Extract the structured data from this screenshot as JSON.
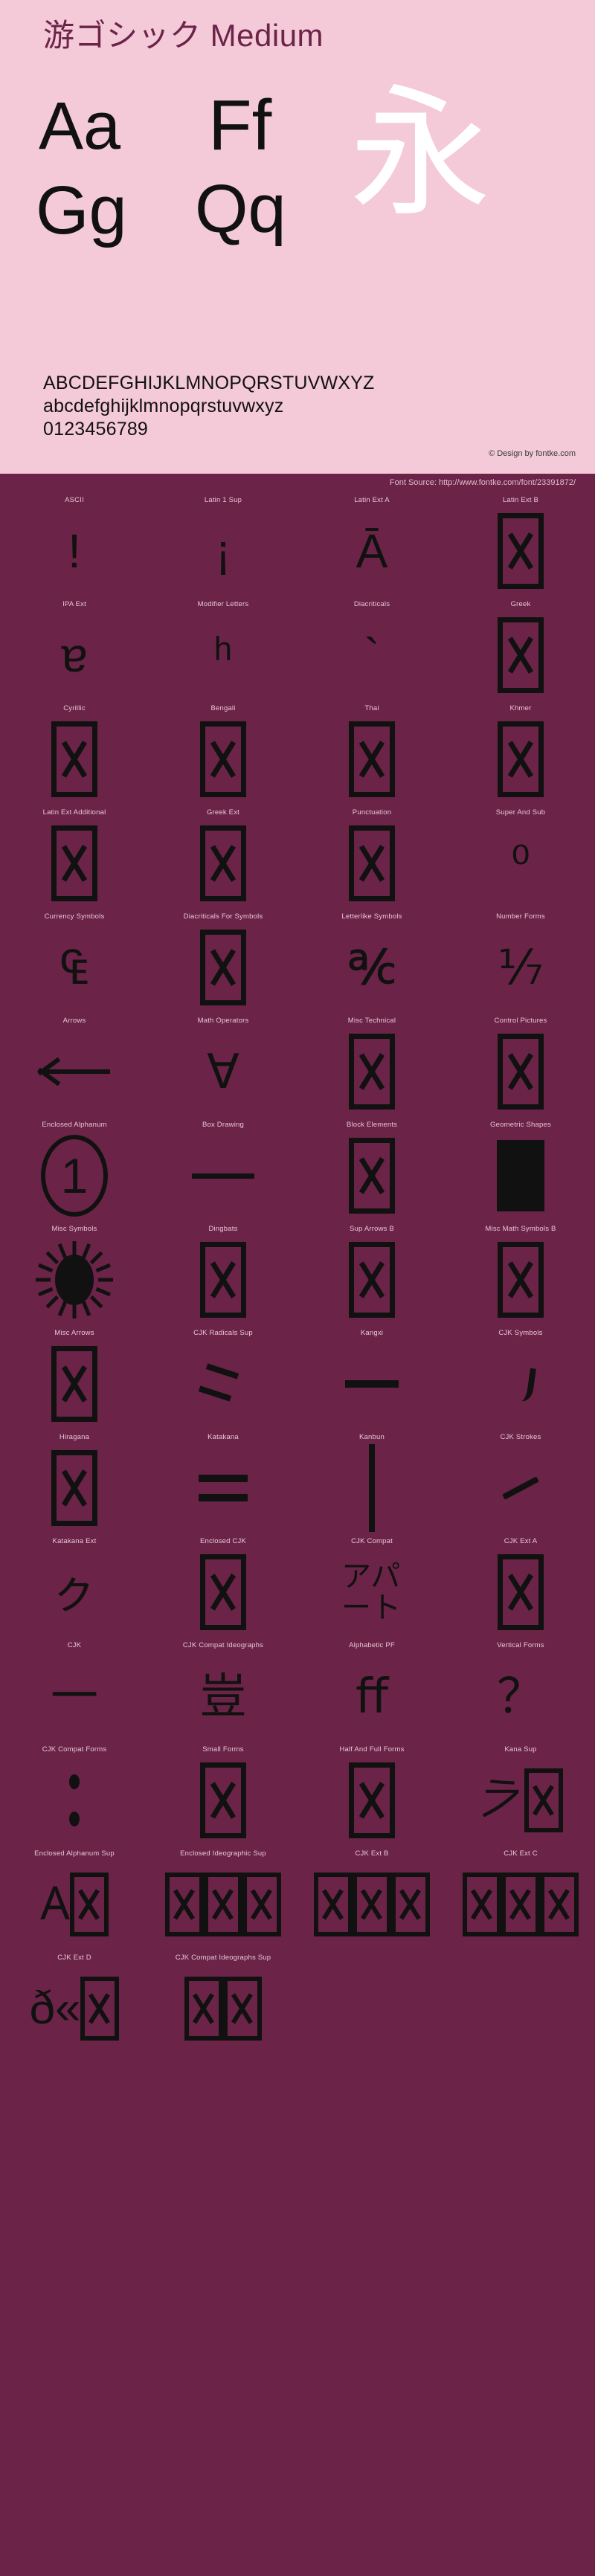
{
  "header": {
    "font_title": "游ゴシック Medium",
    "specimen_pairs": [
      {
        "name": "Aa",
        "text": "Aa"
      },
      {
        "name": "Ff",
        "text": "Ff"
      },
      {
        "name": "Gg",
        "text": "Gg"
      },
      {
        "name": "Qq",
        "text": "Qq"
      }
    ],
    "kanji_sample": "永",
    "charset": {
      "uppercase": "ABCDEFGHIJKLMNOPQRSTUVWXYZ",
      "lowercase": "abcdefghijklmnopqrstuvwxyz",
      "digits": "0123456789"
    },
    "design_credit": "© Design by fontke.com"
  },
  "source_bar": {
    "text": "Font Source: http://www.fontke.com/font/23391872/"
  },
  "blocks": [
    [
      {
        "label": "ASCII",
        "glyph": "!",
        "kind": "glyph"
      },
      {
        "label": "Latin 1 Sup",
        "glyph": "¡",
        "kind": "glyph"
      },
      {
        "label": "Latin Ext A",
        "glyph": "Ā",
        "kind": "glyph"
      },
      {
        "label": "Latin Ext B",
        "glyph": "",
        "kind": "tofu"
      }
    ],
    [
      {
        "label": "IPA Ext",
        "glyph": "ɐ",
        "kind": "glyph"
      },
      {
        "label": "Modifier Letters",
        "glyph": "ʰ",
        "kind": "glyph"
      },
      {
        "label": "Diacriticals",
        "glyph": "`",
        "kind": "glyph"
      },
      {
        "label": "Greek",
        "glyph": "",
        "kind": "tofu"
      }
    ],
    [
      {
        "label": "Cyrillic",
        "glyph": "",
        "kind": "tofu"
      },
      {
        "label": "Bengali",
        "glyph": "",
        "kind": "tofu"
      },
      {
        "label": "Thai",
        "glyph": "",
        "kind": "tofu"
      },
      {
        "label": "Khmer",
        "glyph": "",
        "kind": "tofu"
      }
    ],
    [
      {
        "label": "Latin Ext Additional",
        "glyph": "",
        "kind": "tofu"
      },
      {
        "label": "Greek Ext",
        "glyph": "",
        "kind": "tofu"
      },
      {
        "label": "Punctuation",
        "glyph": "",
        "kind": "tofu"
      },
      {
        "label": "Super And Sub",
        "glyph": "⁰",
        "kind": "glyph"
      }
    ],
    [
      {
        "label": "Currency Symbols",
        "glyph": "₠",
        "kind": "glyph"
      },
      {
        "label": "Diacriticals For Symbols",
        "glyph": "",
        "kind": "tofu"
      },
      {
        "label": "Letterlike Symbols",
        "glyph": "℀",
        "kind": "glyph"
      },
      {
        "label": "Number Forms",
        "glyph": "⅐",
        "kind": "glyph"
      }
    ],
    [
      {
        "label": "Arrows",
        "glyph": "←",
        "kind": "arrow-left"
      },
      {
        "label": "Math Operators",
        "glyph": "∀",
        "kind": "glyph"
      },
      {
        "label": "Misc Technical",
        "glyph": "",
        "kind": "tofu"
      },
      {
        "label": "Control Pictures",
        "glyph": "",
        "kind": "tofu"
      }
    ],
    [
      {
        "label": "Enclosed Alphanum",
        "glyph": "1",
        "kind": "circled"
      },
      {
        "label": "Box Drawing",
        "glyph": "─",
        "kind": "dash"
      },
      {
        "label": "Block Elements",
        "glyph": "",
        "kind": "tofu"
      },
      {
        "label": "Geometric Shapes",
        "glyph": "■",
        "kind": "square"
      }
    ],
    [
      {
        "label": "Misc Symbols",
        "glyph": "☀",
        "kind": "sun"
      },
      {
        "label": "Dingbats",
        "glyph": "",
        "kind": "tofu"
      },
      {
        "label": "Sup Arrows B",
        "glyph": "",
        "kind": "tofu"
      },
      {
        "label": "Misc Math Symbols B",
        "glyph": "",
        "kind": "tofu"
      }
    ],
    [
      {
        "label": "Misc Arrows",
        "glyph": "",
        "kind": "tofu"
      },
      {
        "label": "CJK Radicals Sup",
        "glyph": "⺀",
        "kind": "slashes"
      },
      {
        "label": "Kangxi",
        "glyph": "⼀",
        "kind": "kangxi"
      },
      {
        "label": "CJK Symbols",
        "glyph": "、",
        "kind": "stroke-curve"
      }
    ],
    [
      {
        "label": "Hiragana",
        "glyph": "",
        "kind": "tofu"
      },
      {
        "label": "Katakana",
        "glyph": "゠",
        "kind": "dbar"
      },
      {
        "label": "Kanbun",
        "glyph": "㆐",
        "kind": "vbar"
      },
      {
        "label": "CJK Strokes",
        "glyph": "㇀",
        "kind": "stroke-slash"
      }
    ],
    [
      {
        "label": "Katakana Ext",
        "glyph": "ㇰ",
        "kind": "glyph"
      },
      {
        "label": "Enclosed CJK",
        "glyph": "",
        "kind": "tofu"
      },
      {
        "label": "CJK Compat",
        "glyph": "アパート",
        "kind": "glyph-stack"
      },
      {
        "label": "CJK Ext A",
        "glyph": "",
        "kind": "tofu"
      }
    ],
    [
      {
        "label": "CJK",
        "glyph": "一",
        "kind": "glyph"
      },
      {
        "label": "CJK Compat Ideographs",
        "glyph": "豈",
        "kind": "glyph"
      },
      {
        "label": "Alphabetic PF",
        "glyph": "ﬀ",
        "kind": "glyph"
      },
      {
        "label": "Vertical Forms",
        "glyph": "？",
        "kind": "glyph"
      }
    ],
    [
      {
        "label": "CJK Compat Forms",
        "glyph": "︰",
        "kind": "dots"
      },
      {
        "label": "Small Forms",
        "glyph": "",
        "kind": "tofu"
      },
      {
        "label": "Half And Full Forms",
        "glyph": "",
        "kind": "tofu"
      },
      {
        "label": "Kana Sup",
        "glyph": "𛀀",
        "kind": "glyph-plus-tofu"
      }
    ],
    [
      {
        "label": "Enclosed Alphanum Sup",
        "glyph": "𐊠",
        "kind": "glyph-plus-tofu"
      },
      {
        "label": "Enclosed Ideographic Sup",
        "glyph": "",
        "kind": "tofu-strip-wide"
      },
      {
        "label": "CJK Ext B",
        "glyph": "",
        "kind": "tofu-strip-wide"
      },
      {
        "label": "CJK Ext C",
        "glyph": "",
        "kind": "tofu-strip-wide"
      }
    ],
    [
      {
        "label": "CJK Ext D",
        "glyph": "ð«",
        "kind": "glyph-plus-tofu"
      },
      {
        "label": "CJK Compat Ideographs Sup",
        "glyph": "",
        "kind": "tofu-strip-2"
      },
      {
        "label": "",
        "glyph": "",
        "kind": "none"
      },
      {
        "label": "",
        "glyph": "",
        "kind": "none"
      }
    ]
  ]
}
